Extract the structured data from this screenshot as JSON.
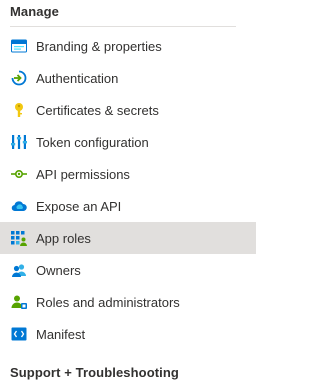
{
  "manage": {
    "title": "Manage",
    "items": [
      {
        "label": "Branding & properties",
        "icon": "branding-icon"
      },
      {
        "label": "Authentication",
        "icon": "authentication-icon"
      },
      {
        "label": "Certificates & secrets",
        "icon": "key-icon"
      },
      {
        "label": "Token configuration",
        "icon": "token-configuration-icon"
      },
      {
        "label": "API permissions",
        "icon": "api-permissions-icon"
      },
      {
        "label": "Expose an API",
        "icon": "cloud-icon"
      },
      {
        "label": "App roles",
        "icon": "app-roles-icon",
        "selected": true
      },
      {
        "label": "Owners",
        "icon": "owners-icon"
      },
      {
        "label": "Roles and administrators",
        "icon": "roles-admins-icon"
      },
      {
        "label": "Manifest",
        "icon": "manifest-icon"
      }
    ]
  },
  "support": {
    "title": "Support + Troubleshooting"
  },
  "colors": {
    "selected_bg": "#e1dfdd",
    "text": "#323130",
    "accent_blue": "#0078d4",
    "accent_green": "#57a300",
    "key_yellow": "#f2c811"
  }
}
